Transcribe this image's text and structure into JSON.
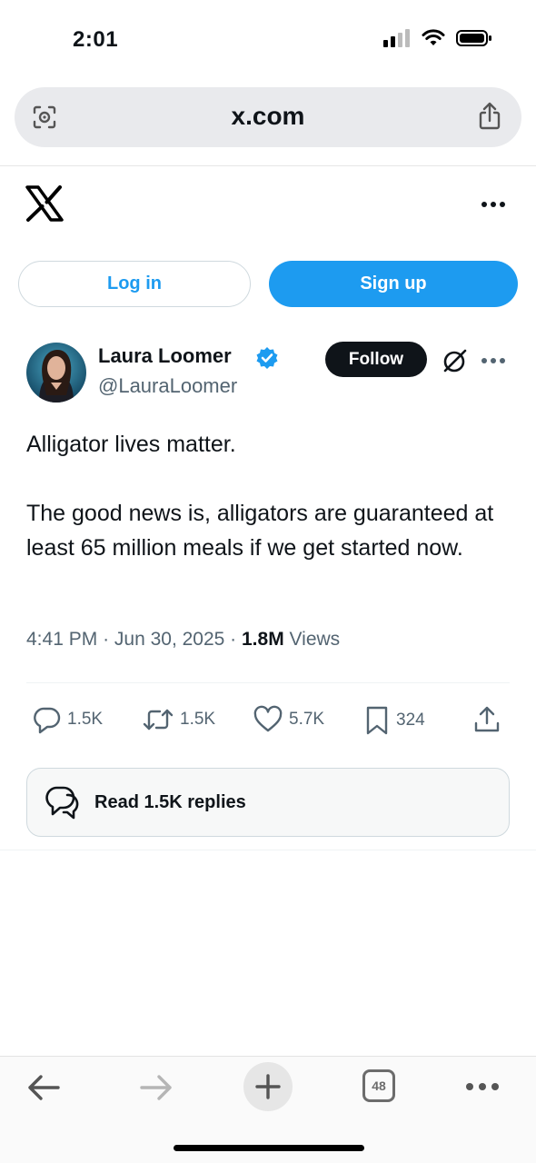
{
  "status_bar": {
    "time": "2:01"
  },
  "browser": {
    "url": "x.com",
    "tab_count": "48"
  },
  "auth": {
    "login_label": "Log in",
    "signup_label": "Sign up"
  },
  "tweet": {
    "display_name": "Laura Loomer",
    "handle": "@LauraLoomer",
    "follow_label": "Follow",
    "text": "Alligator lives matter.\n\nThe good news is, alligators are guaranteed at least 65 million meals if we get started now.",
    "time": "4:41 PM",
    "date": "Jun 30, 2025",
    "views_count": "1.8M",
    "views_label": "Views",
    "replies": "1.5K",
    "reposts": "1.5K",
    "likes": "5.7K",
    "bookmarks": "324",
    "read_replies_label": "Read 1.5K replies"
  },
  "colors": {
    "accent": "#1d9bf0",
    "text_primary": "#0f1419",
    "text_secondary": "#536471"
  }
}
